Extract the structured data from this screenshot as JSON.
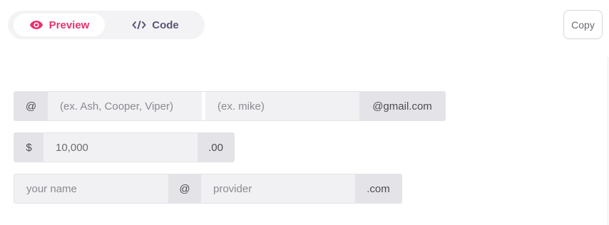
{
  "tabs": {
    "preview_label": "Preview",
    "code_label": "Code"
  },
  "toolbar": {
    "copy_label": "Copy"
  },
  "row1": {
    "prefix": "@",
    "handle_placeholder": "(ex. Ash, Cooper, Viper)",
    "email_placeholder": "(ex. mike)",
    "suffix": "@gmail.com"
  },
  "row2": {
    "prefix": "$",
    "amount_value": "10,000",
    "suffix": ".00"
  },
  "row3": {
    "name_placeholder": "your name",
    "middle": "@",
    "provider_placeholder": "provider",
    "suffix": ".com"
  },
  "colors": {
    "accent": "#e6336e",
    "code_tab": "#5b5575"
  },
  "icons": {
    "preview": "eye-icon",
    "code": "code-brackets-icon"
  }
}
